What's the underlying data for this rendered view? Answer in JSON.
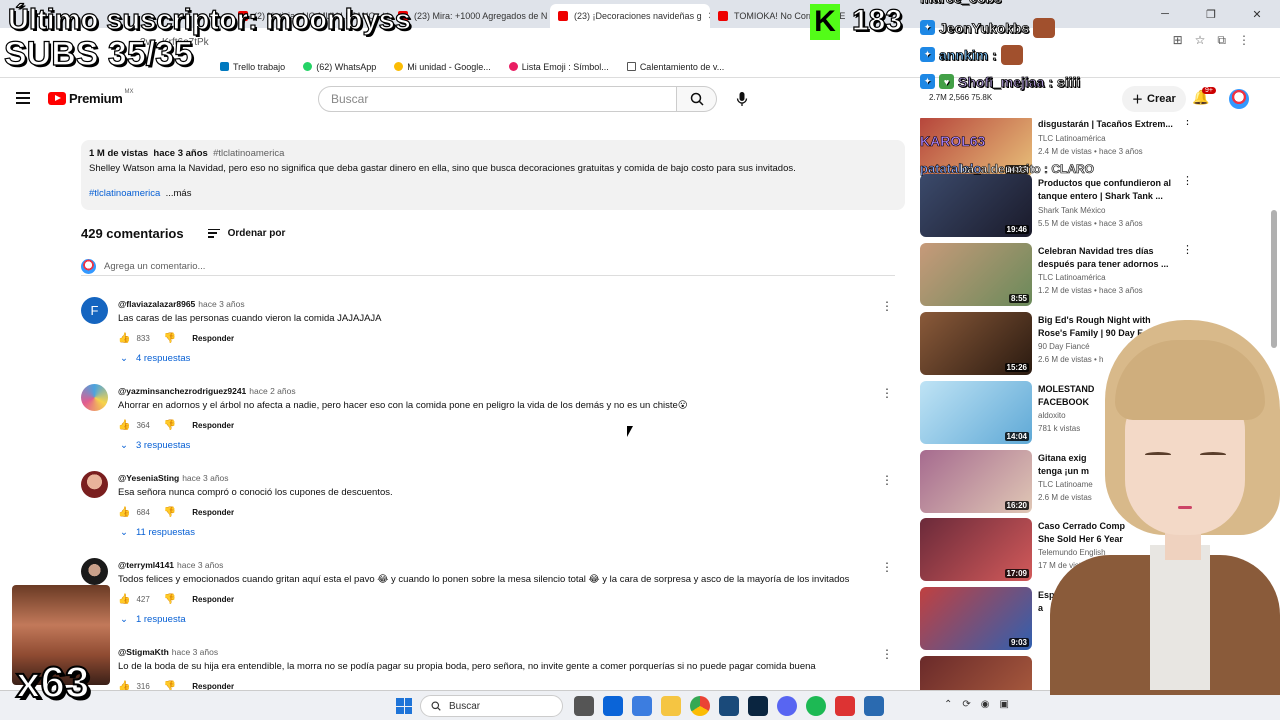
{
  "browser": {
    "tabs": [
      {
        "label": "(2) Nu Tube"
      },
      {
        "label": "(2) Noticias NO MUY LEJANO"
      },
      {
        "label": "(23) Mira: +1000 Agregados de N"
      },
      {
        "label": "(23) ¡Decoraciones navideñas g"
      },
      {
        "label": "TOMIOKA! No Corras! OPE"
      }
    ],
    "url": "?v=_Krft6e7tPk",
    "bookmarks": [
      "Trello trabajo",
      "(62) WhatsApp",
      "Mi unidad - Google...",
      "Lista Emoji : Símbol...",
      "Calentamiento de v..."
    ]
  },
  "youtube": {
    "logo_text": "Premium",
    "region": "MX",
    "search_placeholder": "Buscar",
    "create_label": "Crear",
    "notif_badge": "9+"
  },
  "description": {
    "views": "1 M de vistas",
    "age": "hace 3 años",
    "tag": "#tlclatinoamerica",
    "text": "Shelley Watson ama la Navidad, pero eso no significa que deba gastar dinero en ella, sino que busca decoraciones gratuitas y comida de bajo costo para sus invitados.",
    "hashtag": "#tlclatinoamerica",
    "more": "...más"
  },
  "comments_header": {
    "count": "429 comentarios",
    "sort_label": "Ordenar por",
    "add_placeholder": "Agrega un comentario..."
  },
  "comments": [
    {
      "initial": "F",
      "avatar_color": "#1565c0",
      "handle": "@flaviazalazar8965",
      "time": "hace 3 años",
      "text": "Las caras de las personas cuando vieron la comida JAJAJAJA",
      "likes": "833",
      "reply": "Responder",
      "replies": "4 respuestas"
    },
    {
      "initial": "",
      "avatar_color": "#4aa3df",
      "handle": "@yazminsanchezrodriguez9241",
      "time": "hace 2 años",
      "text": "Ahorrar en adornos y el árbol no afecta a nadie, pero hacer eso con la comida pone en peligro la vida de los demás y no es un chiste😮",
      "likes": "364",
      "reply": "Responder",
      "replies": "3 respuestas"
    },
    {
      "initial": "",
      "avatar_color": "#a52a2a",
      "handle": "@YeseniaSting",
      "time": "hace 3 años",
      "text": "Esa señora nunca compró o conoció los cupones de descuentos.",
      "likes": "684",
      "reply": "Responder",
      "replies": "11 respuestas"
    },
    {
      "initial": "",
      "avatar_color": "#333333",
      "handle": "@terryml4141",
      "time": "hace 3 años",
      "text": "Todos felices y emocionados cuando gritan aquí esta el pavo 😂  y cuando lo ponen sobre la mesa silencio total 😂  y la cara de sorpresa y asco de la mayoría de los invitados",
      "likes": "427",
      "reply": "Responder",
      "replies": "1 respuesta"
    },
    {
      "initial": "",
      "avatar_color": "#9e9e9e",
      "handle": "@StigmaKth",
      "time": "hace 3 años",
      "text": "Lo de la boda de su hija era entendible, la morra no se podía pagar su propia boda, pero señora, no invite gente a comer porquerías si no puede pagar comida buena",
      "likes": "316",
      "reply": "Responder",
      "replies": ""
    }
  ],
  "recommendations": [
    {
      "title": "disgustarán | Tacaños Extrem...",
      "channel": "TLC Latinoamérica",
      "meta": "2.4 M de vistas • hace 3 años",
      "duration": "14:13",
      "thumb": "#b5433a"
    },
    {
      "title": "Productos que confundieron al tanque entero | Shark Tank ...",
      "channel": "Shark Tank México",
      "meta": "5.5 M de vistas • hace 3 años",
      "duration": "19:46",
      "thumb": "#3b4a6b"
    },
    {
      "title": "Celebran Navidad tres días después para tener adornos ...",
      "channel": "TLC Latinoamérica",
      "meta": "1.2 M de vistas • hace 3 años",
      "duration": "8:55",
      "thumb": "#c79a7a"
    },
    {
      "title": "Big Ed's Rough Night with Rose's Family | 90 Day F...",
      "channel": "90 Day Fiancé",
      "meta": "2.6 M de vistas • h",
      "duration": "15:26",
      "thumb": "#8a5a3a"
    },
    {
      "title": "MOLESTAND FACEBOOK",
      "channel": "aldoxito",
      "meta": "781 k vistas",
      "duration": "14:04",
      "thumb": "#5fa9d6"
    },
    {
      "title": "Gitana exig tenga ¡un m",
      "channel": "TLC Latinoame",
      "meta": "2.6 M de vistas",
      "duration": "16:20",
      "thumb": "#a66b8f"
    },
    {
      "title": "Caso Cerrado Comp She Sold Her 6 Year",
      "channel": "Telemundo English",
      "meta": "17 M de vistas • hac",
      "duration": "17:09",
      "thumb": "#6b2a3a"
    },
    {
      "title": "Esp a",
      "channel": "",
      "meta": "",
      "duration": "9:03",
      "thumb": "#c04040"
    }
  ],
  "overlay": {
    "last_sub": "Último suscriptor: moonbyss",
    "subs": "SUBS 35/35",
    "kick_letter": "K",
    "kick_count": "183",
    "chat": [
      {
        "name": "marce_cobs",
        "msg": ""
      },
      {
        "name": "JeonYukokbs",
        "msg": ""
      },
      {
        "name": "annkim",
        "msg": ""
      },
      {
        "name": "Shofi_mejiaa",
        "msg": ": siiii"
      }
    ],
    "stats": "2.7M  2,566  75.8K",
    "name2": "KAROL63",
    "name3": "patatalolo",
    "name4": "ba_aldenncito : CLARO",
    "multiplier": "x63"
  },
  "taskbar": {
    "search_label": "Buscar"
  }
}
